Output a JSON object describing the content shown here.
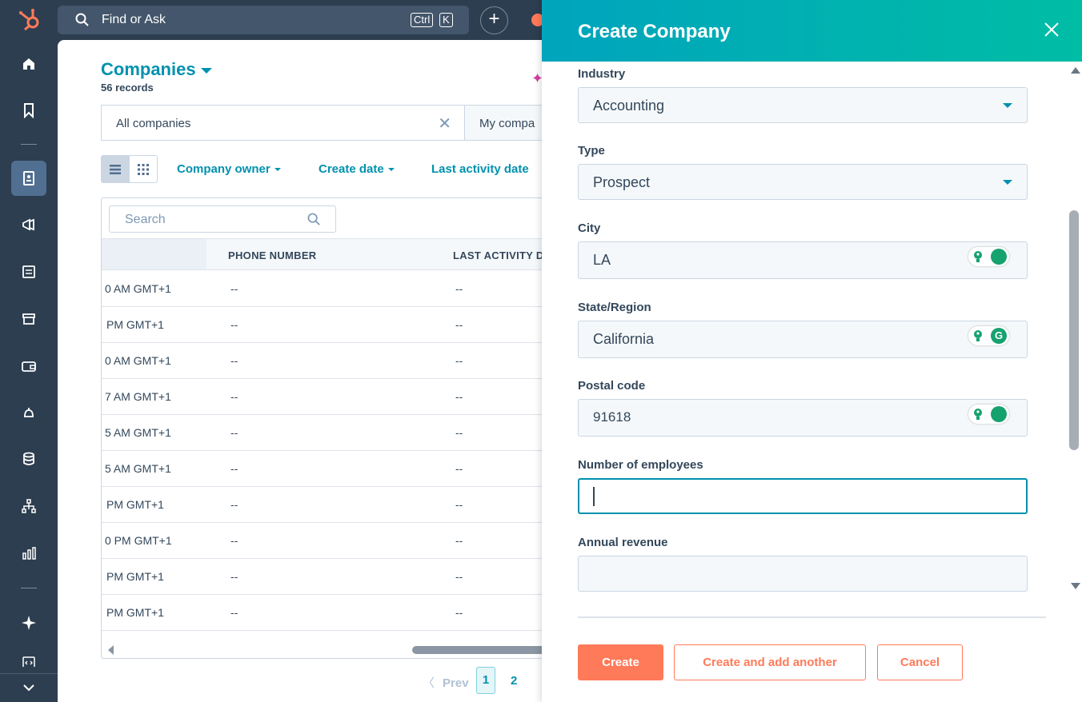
{
  "topbar": {
    "search_text": "Find or Ask",
    "kbd_ctrl": "Ctrl",
    "kbd_k": "K",
    "plus": "+"
  },
  "main": {
    "title": "Companies",
    "records": "56 records",
    "view_tabs": [
      {
        "label": "All companies"
      },
      {
        "label": "My compa"
      }
    ],
    "filters": [
      "Company owner",
      "Create date",
      "Last activity date"
    ],
    "table": {
      "search_placeholder": "Search",
      "columns": [
        "PHONE NUMBER",
        "LAST ACTIVITY D"
      ],
      "rows": [
        {
          "partial": "0 AM GMT+1",
          "phone": "--",
          "last": "--"
        },
        {
          "partial": "PM GMT+1",
          "phone": "--",
          "last": "--"
        },
        {
          "partial": "0 AM GMT+1",
          "phone": "--",
          "last": "--"
        },
        {
          "partial": "7 AM GMT+1",
          "phone": "--",
          "last": "--"
        },
        {
          "partial": "5 AM GMT+1",
          "phone": "--",
          "last": "--"
        },
        {
          "partial": "5 AM GMT+1",
          "phone": "--",
          "last": "--"
        },
        {
          "partial": "PM GMT+1",
          "phone": "--",
          "last": "--"
        },
        {
          "partial": "0 PM GMT+1",
          "phone": "--",
          "last": "--"
        },
        {
          "partial": "PM GMT+1",
          "phone": "--",
          "last": "--"
        },
        {
          "partial": "PM GMT+1",
          "phone": "--",
          "last": "--"
        }
      ]
    },
    "pagination": {
      "prev": "Prev",
      "page1": "1",
      "page2": "2"
    }
  },
  "panel": {
    "title": "Create Company",
    "fields": {
      "industry": {
        "label": "Industry",
        "value": "Accounting"
      },
      "type": {
        "label": "Type",
        "value": "Prospect"
      },
      "city": {
        "label": "City",
        "value": "LA"
      },
      "state": {
        "label": "State/Region",
        "value": "California"
      },
      "postal": {
        "label": "Postal code",
        "value": "91618"
      },
      "employees": {
        "label": "Number of employees",
        "value": ""
      },
      "revenue": {
        "label": "Annual revenue",
        "value": ""
      }
    },
    "buttons": {
      "create": "Create",
      "create_another": "Create and add another",
      "cancel": "Cancel"
    }
  },
  "colors": {
    "brand_teal": "#0091ae",
    "accent_orange": "#ff7a59",
    "nav_bg": "#2d3e50"
  },
  "icons": [
    "hubspot-logo-icon",
    "search-icon",
    "home-icon",
    "bookmark-icon",
    "contacts-icon",
    "megaphone-icon",
    "document-icon",
    "store-icon",
    "wallet-icon",
    "bell-service-icon",
    "database-icon",
    "org-chart-icon",
    "bar-chart-icon",
    "sparkle-icon",
    "code-icon",
    "chevron-down-icon",
    "close-icon"
  ]
}
